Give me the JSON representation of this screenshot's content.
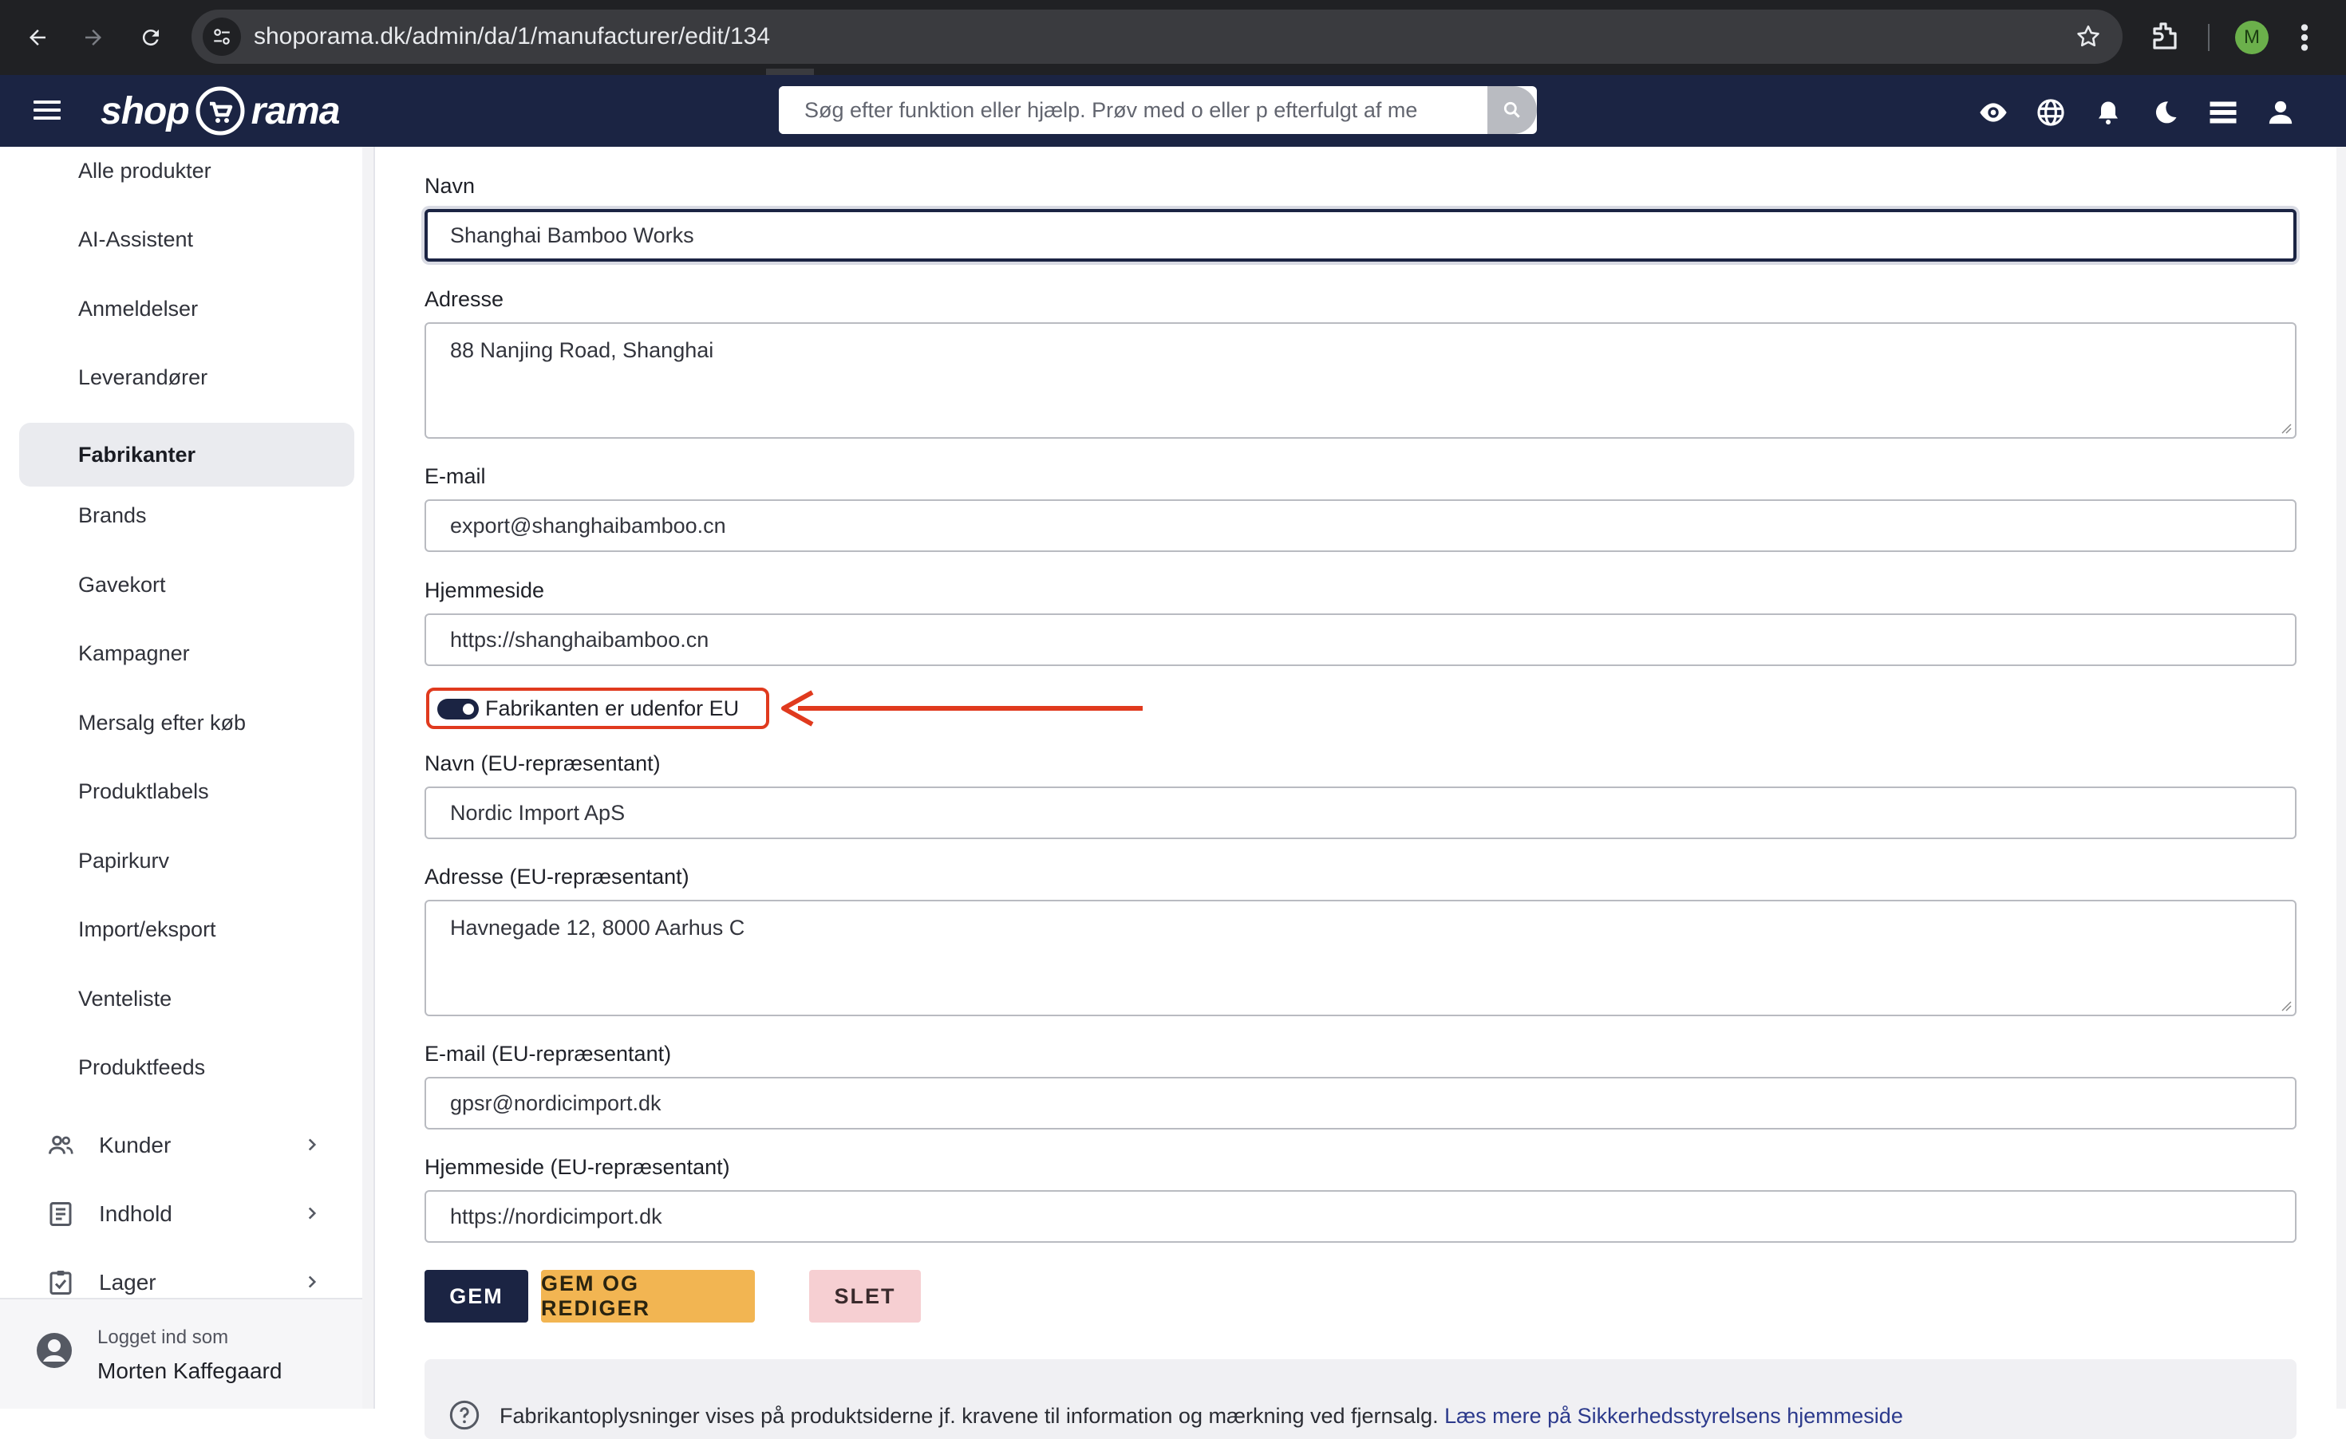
{
  "browser": {
    "url": "shoporama.dk/admin/da/1/manufacturer/edit/134",
    "profile_initial": "M"
  },
  "header": {
    "logo_left": "shop",
    "logo_right": "rama",
    "search_placeholder": "Søg efter funktion eller hjælp. Prøv med o eller p efterfulgt af me",
    "icons": [
      "eye-icon",
      "globe-icon",
      "bell-icon",
      "moon-icon",
      "storage-icon",
      "person-icon"
    ],
    "colors": {
      "header_bg": "#1b2443",
      "accent": "#f2b552",
      "danger": "#f6cfd2"
    }
  },
  "sidebar": {
    "items": [
      {
        "label": "Alle produkter"
      },
      {
        "label": "AI-Assistent"
      },
      {
        "label": "Anmeldelser"
      },
      {
        "label": "Leverandører"
      },
      {
        "label": "Fabrikanter",
        "active": true
      },
      {
        "label": "Brands"
      },
      {
        "label": "Gavekort"
      },
      {
        "label": "Kampagner"
      },
      {
        "label": "Mersalg efter køb"
      },
      {
        "label": "Produktlabels"
      },
      {
        "label": "Papirkurv"
      },
      {
        "label": "Import/eksport"
      },
      {
        "label": "Venteliste"
      },
      {
        "label": "Produktfeeds"
      }
    ],
    "groups": [
      {
        "label": "Kunder",
        "icon": "people-icon"
      },
      {
        "label": "Indhold",
        "icon": "document-icon"
      },
      {
        "label": "Lager",
        "icon": "clipboard-check-icon"
      }
    ],
    "user": {
      "logged_in_as": "Logget ind som",
      "name": "Morten Kaffegaard"
    }
  },
  "form": {
    "name": {
      "label": "Navn",
      "value": "Shanghai Bamboo Works"
    },
    "address": {
      "label": "Adresse",
      "value": "88 Nanjing Road, Shanghai"
    },
    "email": {
      "label": "E-mail",
      "value": "export@shanghaibamboo.cn"
    },
    "website": {
      "label": "Hjemmeside",
      "value": "https://shanghaibamboo.cn"
    },
    "outside_eu": {
      "label": "Fabrikanten er udenfor EU",
      "checked": true
    },
    "eu_name": {
      "label": "Navn (EU-repræsentant)",
      "value": "Nordic Import ApS"
    },
    "eu_address": {
      "label": "Adresse (EU-repræsentant)",
      "value": "Havnegade 12, 8000 Aarhus C"
    },
    "eu_email": {
      "label": "E-mail (EU-repræsentant)",
      "value": "gpsr@nordicimport.dk"
    },
    "eu_website": {
      "label": "Hjemmeside (EU-repræsentant)",
      "value": "https://nordicimport.dk"
    }
  },
  "buttons": {
    "save": "GEM",
    "save_edit": "GEM OG REDIGER",
    "delete": "SLET"
  },
  "info": {
    "text": "Fabrikantoplysninger vises på produktsiderne jf. kravene til information og mærkning ved fjernsalg. ",
    "link": "Læs mere på Sikkerhedsstyrelsens hjemmeside"
  }
}
